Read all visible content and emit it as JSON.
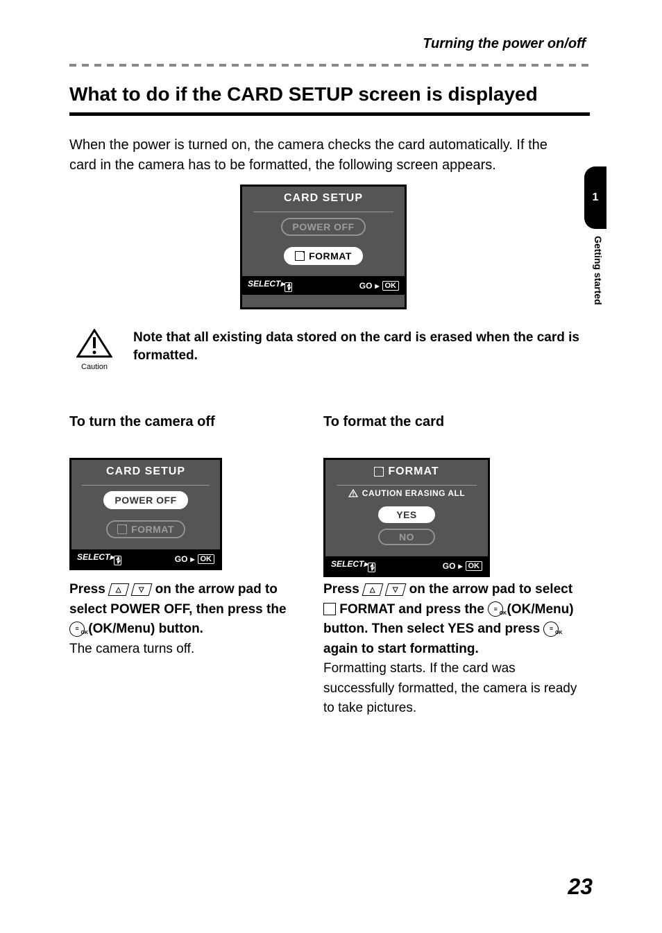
{
  "header": {
    "title": "Turning the power on/off"
  },
  "heading": "What to do if the CARD SETUP screen is displayed",
  "intro": "When the power is turned on, the camera checks the card automatically. If the card in the camera has to be formatted, the following screen appears.",
  "lcd_main": {
    "title": "CARD SETUP",
    "option1": "POWER OFF",
    "option2": "FORMAT",
    "footer_select": "SELECT",
    "footer_go": "GO",
    "footer_ok": "OK"
  },
  "caution": {
    "label": "Caution",
    "text": "Note that all existing data stored on the card is erased when the card is formatted."
  },
  "left": {
    "subhead": "To turn the camera off",
    "lcd": {
      "title": "CARD SETUP",
      "option1": "POWER OFF",
      "option2": "FORMAT",
      "footer_select": "SELECT",
      "footer_go": "GO",
      "footer_ok": "OK"
    },
    "instr_l1a": "Press ",
    "instr_l1b": " on the arrow pad to select POWER OFF, then press the ",
    "instr_l1c": " (OK/Menu) button.",
    "instr_l2": "The camera turns off."
  },
  "right": {
    "subhead": "To format the card",
    "lcd": {
      "title": "FORMAT",
      "caution_line": "CAUTION  ERASING ALL",
      "option1": "YES",
      "option2": "NO",
      "footer_select": "SELECT",
      "footer_go": "GO",
      "footer_ok": "OK"
    },
    "instr_l1a": "Press ",
    "instr_l1b": " on the arrow pad to select ",
    "instr_l1c": " FORMAT and press the ",
    "instr_l1d": " (OK/Menu) button. Then select YES and press ",
    "instr_l1e": " again to start formatting.",
    "instr_l2": "Formatting starts. If the card was successfully formatted, the camera is ready to take pictures."
  },
  "side": {
    "chapter": "1",
    "label": "Getting started"
  },
  "page_number": "23"
}
